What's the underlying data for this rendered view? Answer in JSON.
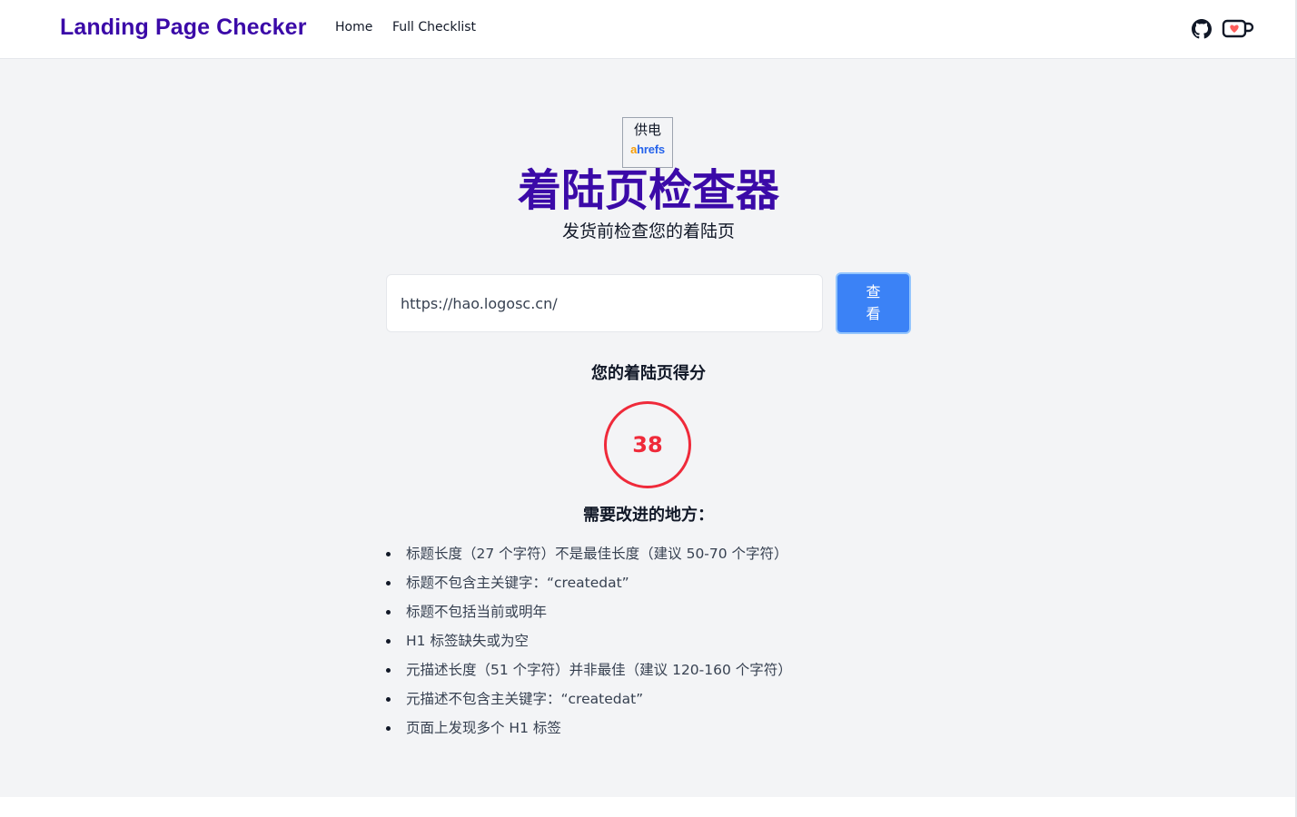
{
  "navbar": {
    "brand": "Landing Page Checker",
    "links": [
      {
        "label": "Home"
      },
      {
        "label": "Full Checklist"
      }
    ],
    "icons": [
      "github-icon",
      "ko-fi-cup-icon"
    ]
  },
  "powered_by": {
    "label": "供电",
    "logo_prefix": "a",
    "logo_rest": "hrefs"
  },
  "hero": {
    "title": "着陆页检查器",
    "subtitle": "发货前检查您的着陆页"
  },
  "search": {
    "value": "https://hao.logosc.cn/",
    "button_label": "查看"
  },
  "score": {
    "heading": "您的着陆页得分",
    "value": "38",
    "color": "#ef2a3a"
  },
  "improvements": {
    "heading": "需要改进的地方：",
    "items": [
      "标题长度（27 个字符）不是最佳长度（建议 50-70 个字符）",
      "标题不包含主关键字：“createdat”",
      "标题不包括当前或明年",
      "H1 标签缺失或为空",
      "元描述长度（51 个字符）并非最佳（建议 120-160 个字符）",
      "元描述不包含主关键字：“createdat”",
      "页面上发现多个 H1 标签"
    ]
  },
  "colors": {
    "brand": "#3b0aa8",
    "button": "#3b82f6",
    "background": "#f3f4f6"
  }
}
